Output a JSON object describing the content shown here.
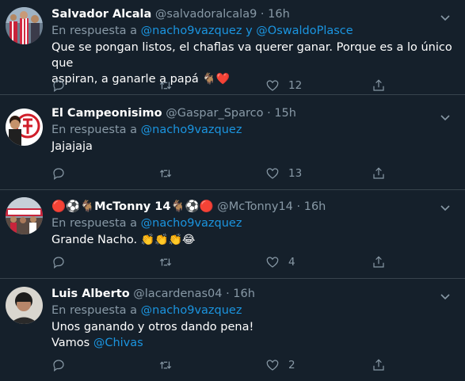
{
  "tweets": [
    {
      "name": "Salvador Alcala",
      "handle": "@salvadoralcala9",
      "time": "16h",
      "reply_prefix": "En respuesta a",
      "mention1": "@nacho9vazquez",
      "conj": "y",
      "mention2": "@OswaldoPlasce",
      "text_line1": "Que se pongan listos, el chaflas va querer ganar. Porque es a lo único que",
      "text_line2": "aspiran, a ganarle a papá",
      "emoji": "🐐❤️",
      "likes": "12"
    },
    {
      "name": "El Campeonisimo",
      "handle": "@Gaspar_Sparco",
      "time": "15h",
      "reply_prefix": "En respuesta a",
      "mention1": "@nacho9vazquez",
      "text_line1": "Jajajaja",
      "likes": "13"
    },
    {
      "name_prefix": "🔴⚽🐐",
      "name": "McTonny 14",
      "name_suffix": "🐐⚽🔴",
      "handle": "@McTonny14",
      "time": "16h",
      "reply_prefix": "En respuesta a",
      "mention1": "@nacho9vazquez",
      "text_line1": "Grande Nacho.",
      "emoji": "👏👏👏😂",
      "likes": "4"
    },
    {
      "name": "Luis Alberto",
      "handle": "@lacardenas04",
      "time": "16h",
      "reply_prefix": "En respuesta a",
      "mention1": "@nacho9vazquez",
      "text_line1": "Unos ganando y otros dando pena!",
      "text_line2_prefix": "Vamos",
      "mention_inline": "@Chivas",
      "likes": "2"
    }
  ],
  "separator": "·",
  "colors": {
    "background": "#15202b",
    "border": "#38444d",
    "secondary_text": "#8899a6",
    "link": "#1b95e0"
  },
  "icons": [
    "reply-icon",
    "retweet-icon",
    "like-icon",
    "share-icon",
    "chevron-down-icon"
  ]
}
